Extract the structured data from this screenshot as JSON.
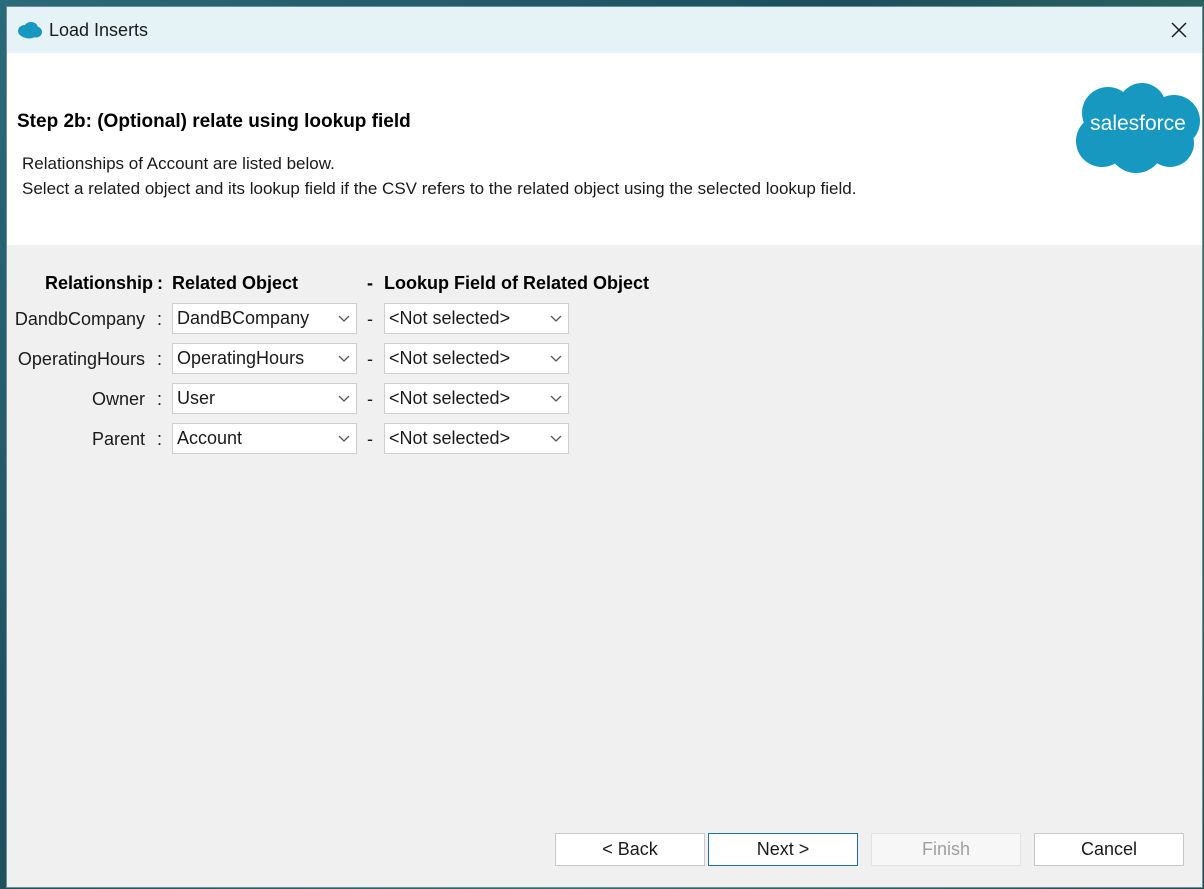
{
  "window": {
    "title": "Load Inserts",
    "close_icon": "close-icon"
  },
  "header": {
    "step_title": "Step 2b: (Optional) relate using lookup field",
    "description_line1": "Relationships of Account are listed below.",
    "description_line2": "Select a related object and its lookup field if the CSV refers to the related object using the selected lookup field.",
    "logo_text": "salesforce",
    "logo_color": "#1798c1"
  },
  "grid": {
    "col_relationship": "Relationship",
    "colon": ":",
    "col_related_object": "Related Object",
    "dash": "-",
    "col_lookup_field": "Lookup Field of Related Object",
    "rows": [
      {
        "relationship": "DandbCompany",
        "related_object": "DandBCompany",
        "lookup_field": "<Not selected>"
      },
      {
        "relationship": "OperatingHours",
        "related_object": "OperatingHours",
        "lookup_field": "<Not selected>"
      },
      {
        "relationship": "Owner",
        "related_object": "User",
        "lookup_field": "<Not selected>"
      },
      {
        "relationship": "Parent",
        "related_object": "Account",
        "lookup_field": "<Not selected>"
      }
    ]
  },
  "buttons": {
    "back": "< Back",
    "next": "Next >",
    "finish": "Finish",
    "cancel": "Cancel"
  },
  "colors": {
    "primary_border": "#1f6fa8",
    "titlebar_bg": "#e6f3f6"
  }
}
